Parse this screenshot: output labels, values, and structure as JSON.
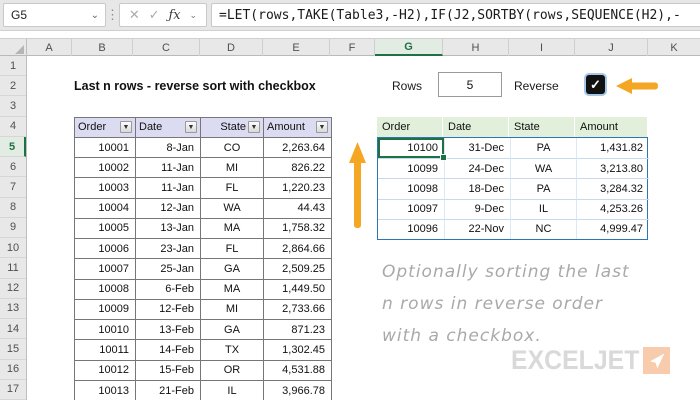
{
  "formula_bar": {
    "name_box": "G5",
    "formula": "=LET(rows,TAKE(Table3,-H2),IF(J2,SORTBY(rows,SEQUENCE(H2),-"
  },
  "icons": {
    "cancel": "✕",
    "confirm": "✓",
    "fx": "ƒx",
    "chevron_down": "⌄",
    "dots": "⋮",
    "filter_arrow": "▼",
    "check": "✓"
  },
  "grid": {
    "column_letters": [
      "A",
      "B",
      "C",
      "D",
      "E",
      "F",
      "G",
      "H",
      "I",
      "J",
      "K"
    ],
    "row_numbers": [
      1,
      2,
      3,
      4,
      5,
      6,
      7,
      8,
      9,
      10,
      11,
      12,
      13,
      14,
      15,
      16,
      17
    ],
    "active_column": "G",
    "active_row": 5
  },
  "title": "Last n rows - reverse sort with checkbox",
  "controls": {
    "rows_label": "Rows",
    "rows_value": "5",
    "reverse_label": "Reverse",
    "checkbox_checked": true
  },
  "source_table": {
    "headers": [
      "Order",
      "Date",
      "State",
      "Amount"
    ],
    "rows": [
      [
        "10001",
        "8-Jan",
        "CO",
        "2,263.64"
      ],
      [
        "10002",
        "11-Jan",
        "MI",
        "826.22"
      ],
      [
        "10003",
        "11-Jan",
        "FL",
        "1,220.23"
      ],
      [
        "10004",
        "12-Jan",
        "WA",
        "44.43"
      ],
      [
        "10005",
        "13-Jan",
        "MA",
        "1,758.32"
      ],
      [
        "10006",
        "23-Jan",
        "FL",
        "2,864.66"
      ],
      [
        "10007",
        "25-Jan",
        "GA",
        "2,509.25"
      ],
      [
        "10008",
        "6-Feb",
        "MA",
        "1,449.50"
      ],
      [
        "10009",
        "12-Feb",
        "MI",
        "2,733.66"
      ],
      [
        "10010",
        "13-Feb",
        "GA",
        "871.23"
      ],
      [
        "10011",
        "14-Feb",
        "TX",
        "1,302.45"
      ],
      [
        "10012",
        "15-Feb",
        "OR",
        "4,531.88"
      ],
      [
        "10013",
        "21-Feb",
        "IL",
        "3,966.78"
      ]
    ]
  },
  "result_table": {
    "headers": [
      "Order",
      "Date",
      "State",
      "Amount"
    ],
    "rows": [
      [
        "10100",
        "31-Dec",
        "PA",
        "1,431.82"
      ],
      [
        "10099",
        "24-Dec",
        "WA",
        "3,213.80"
      ],
      [
        "10098",
        "18-Dec",
        "PA",
        "3,284.32"
      ],
      [
        "10097",
        "9-Dec",
        "IL",
        "4,253.26"
      ],
      [
        "10096",
        "22-Nov",
        "NC",
        "4,999.47"
      ]
    ]
  },
  "annotation": {
    "lines": [
      "Optionally sorting the last",
      "n rows in reverse order",
      "with a checkbox."
    ]
  },
  "logo": {
    "text": "EXCELJET"
  },
  "colors": {
    "accent_green": "#1e7145",
    "source_header_bg": "#dbdcf2",
    "result_header_bg": "#e2efda",
    "spill_border": "#2e75b6",
    "arrow_orange": "#f5a623",
    "logo_text": "#d9d9d9",
    "logo_square": "#f8cbad",
    "annotation_text": "#a9a9a9"
  }
}
